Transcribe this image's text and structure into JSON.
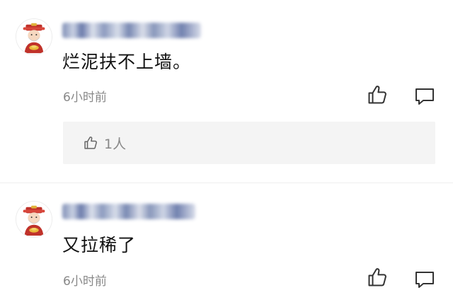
{
  "comments": [
    {
      "avatar": "caishen-avatar",
      "username": "",
      "text": "烂泥扶不上墙。",
      "time": "6小时前",
      "like_icon": "thumbs-up-icon",
      "reply_icon": "comment-bubble-icon",
      "likes_summary": {
        "icon": "thumbs-up-icon",
        "text": "1人"
      }
    },
    {
      "avatar": "caishen-avatar",
      "username": "",
      "text": "又拉稀了",
      "time": "6小时前",
      "like_icon": "thumbs-up-icon",
      "reply_icon": "comment-bubble-icon"
    }
  ],
  "colors": {
    "text": "#111111",
    "meta": "#888888",
    "like_box_bg": "#f4f4f4",
    "divider": "#eeeeee",
    "username_blur": "#5a6ea0"
  }
}
